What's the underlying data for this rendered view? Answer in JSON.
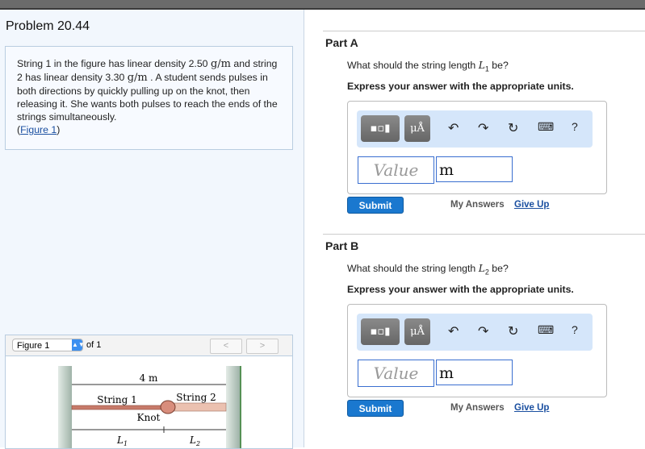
{
  "problem": {
    "title": "Problem 20.44",
    "text_1": "String 1 in the figure has linear density 2.50 ",
    "unit_1": "g/m",
    "text_2": " and string 2 has linear density 3.30 ",
    "unit_2": "g/m",
    "text_3": " . A student sends pulses in both directions by quickly pulling up on the knot, then releasing it. She wants both pulses to reach the ends of the strings simultaneously.",
    "figure_link_open": "(",
    "figure_link": "Figure 1",
    "figure_link_close": ")"
  },
  "figure": {
    "selected": "Figure 1",
    "of": "of 1",
    "prev": "<",
    "next": ">",
    "length_label": "4 m",
    "string1": "String 1",
    "string2": "String 2",
    "knot": "Knot",
    "l1": "L",
    "l1_sub": "1",
    "l2": "L",
    "l2_sub": "2"
  },
  "parts": [
    {
      "header": "Part A",
      "question_pre": "What should the string length ",
      "var": "L",
      "sub": "1",
      "question_post": " be?",
      "express": "Express your answer with the appropriate units.",
      "value_placeholder": "Value",
      "unit": "m",
      "submit": "Submit",
      "my_answers": "My Answers",
      "give_up": "Give Up"
    },
    {
      "header": "Part B",
      "question_pre": "What should the string length ",
      "var": "L",
      "sub": "2",
      "question_post": " be?",
      "express": "Express your answer with the appropriate units.",
      "value_placeholder": "Value",
      "unit": "m",
      "submit": "Submit",
      "my_answers": "My Answers",
      "give_up": "Give Up"
    }
  ],
  "toolbar": {
    "units_label": "μÅ",
    "help": "?"
  }
}
